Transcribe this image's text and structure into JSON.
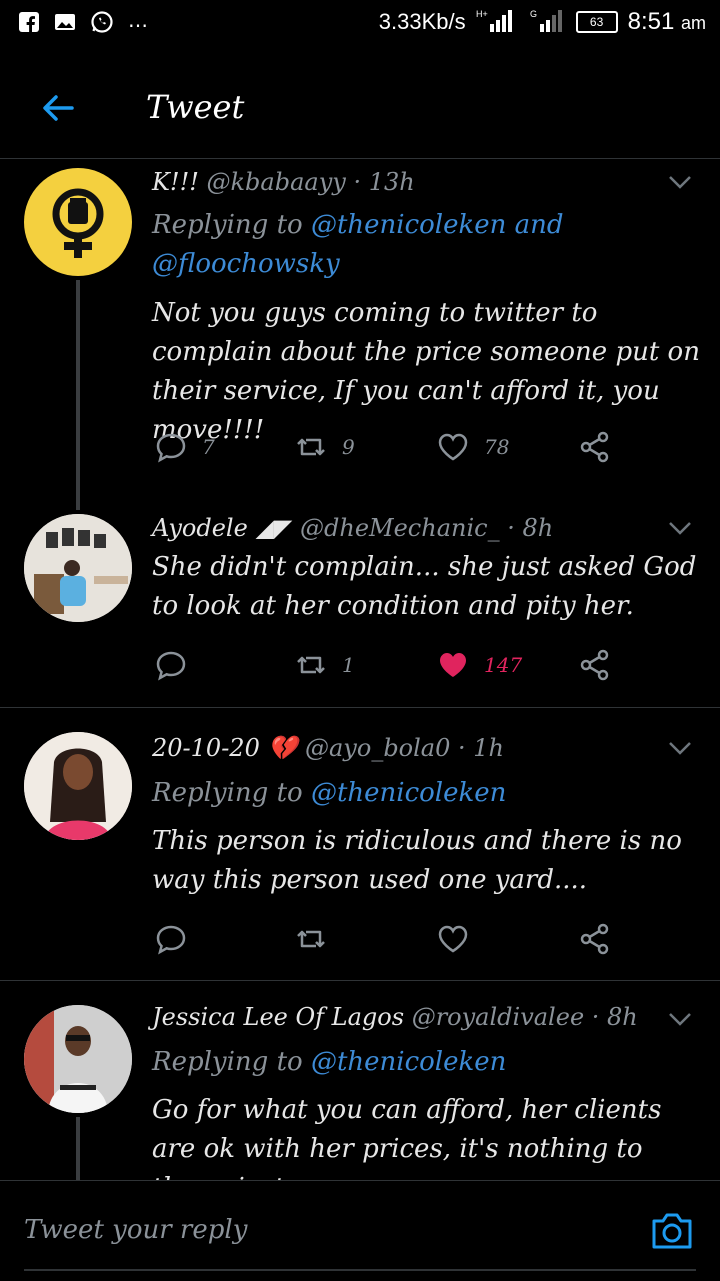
{
  "statusbar": {
    "speed": "3.33Kb/s",
    "battery": "63",
    "time": "8:51",
    "ampm": "am",
    "sim1": "H+ 1",
    "sim2": "G 2",
    "icons": [
      "facebook-icon",
      "gallery-icon",
      "whatsapp-icon",
      "more-icon"
    ]
  },
  "header": {
    "title": "Tweet"
  },
  "tweets": [
    {
      "name": "K!!!",
      "handle": "@kbabaayy",
      "time": "· 13h",
      "replying_prefix": "Replying to ",
      "replying_to": "@thenicoleken and @floochowsky",
      "text": "Not you guys coming to twitter to complain about the price someone put on their service, If you can't afford it, you move!!!!",
      "replies": "7",
      "retweets": "9",
      "likes": "78",
      "avatar_bg": "#f4d03f"
    },
    {
      "name": "Ayodele ◢◤",
      "handle": "@dheMechanic_",
      "time": "· 8h",
      "text": "She didn't complain... she just asked God to look at her condition and pity her.",
      "replies": "",
      "retweets": "1",
      "likes": "147",
      "liked": true
    },
    {
      "name": "20-10-20 💔",
      "handle": "@ayo_bola0",
      "time": "· 1h",
      "replying_prefix": "Replying to ",
      "replying_to": "@thenicoleken",
      "text": "This person is ridiculous and there is no way this person used one yard....",
      "replies": "",
      "retweets": "",
      "likes": ""
    },
    {
      "name": "Jessica Lee Of Lagos",
      "handle": "@royaldivalee",
      "time": "· 8h",
      "replying_prefix": "Replying to ",
      "replying_to": "@thenicoleken",
      "text": "Go for what you can afford, her clients are ok with her prices, it's nothing to them, just"
    }
  ],
  "reply_bar": {
    "placeholder": "Tweet your reply"
  },
  "colors": {
    "link": "#3d8bd6",
    "like": "#e0245e",
    "muted": "#8b9299",
    "background": "#000000"
  }
}
